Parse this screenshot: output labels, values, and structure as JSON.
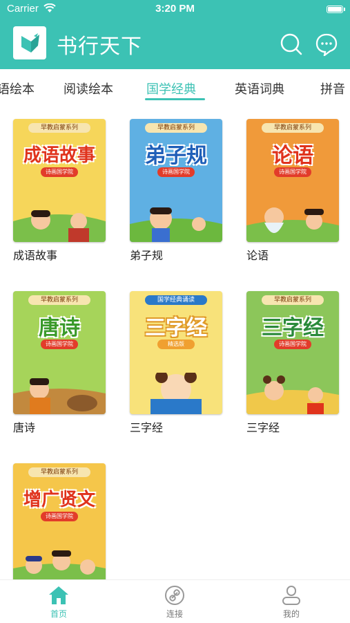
{
  "status_bar": {
    "carrier": "Carrier",
    "time": "3:20 PM"
  },
  "header": {
    "title": "书行天下",
    "icons": [
      "search-icon",
      "message-icon"
    ]
  },
  "tabs": [
    {
      "label": "语绘本"
    },
    {
      "label": "阅读绘本"
    },
    {
      "label": "国学经典",
      "active": true
    },
    {
      "label": "英语词典"
    },
    {
      "label": "拼音"
    }
  ],
  "books": [
    {
      "title": "成语故事",
      "cover_text": "成语故事",
      "banner": "早教启蒙系列",
      "sub": "诗画国学院",
      "bg": "#f6d65a",
      "accent": "#e0331c"
    },
    {
      "title": "弟子规",
      "cover_text": "弟子规",
      "banner": "早教启蒙系列",
      "sub": "诗画国学院",
      "bg": "#5fb0e3",
      "accent": "#e0331c"
    },
    {
      "title": "论语",
      "cover_text": "论语",
      "banner": "早教启蒙系列",
      "sub": "诗画国学院",
      "bg": "#f09a3a",
      "accent": "#e0331c"
    },
    {
      "title": "唐诗",
      "cover_text": "唐诗",
      "banner": "早教启蒙系列",
      "sub": "诗画国学院",
      "bg": "#a6d45a",
      "accent": "#3a9a2a"
    },
    {
      "title": "三字经",
      "cover_text": "三字经",
      "banner": "国学经典诵读",
      "sub": "精选版",
      "bg": "#f8e27a",
      "accent": "#ffffff"
    },
    {
      "title": "三字经",
      "cover_text": "三字经",
      "banner": "早教启蒙系列",
      "sub": "诗画国学院",
      "bg": "#8cc65a",
      "accent": "#2a8a3a"
    },
    {
      "title": "增广贤文",
      "cover_text": "增广贤文",
      "banner": "早教启蒙系列",
      "sub": "诗画国学院",
      "bg": "#f5c64a",
      "accent": "#e0331c"
    }
  ],
  "bottom_nav": [
    {
      "label": "首页",
      "icon": "home-icon",
      "active": true
    },
    {
      "label": "连接",
      "icon": "link-icon"
    },
    {
      "label": "我的",
      "icon": "profile-icon"
    }
  ],
  "colors": {
    "primary": "#3cc2b4",
    "text": "#222222",
    "inactive": "#777777"
  }
}
